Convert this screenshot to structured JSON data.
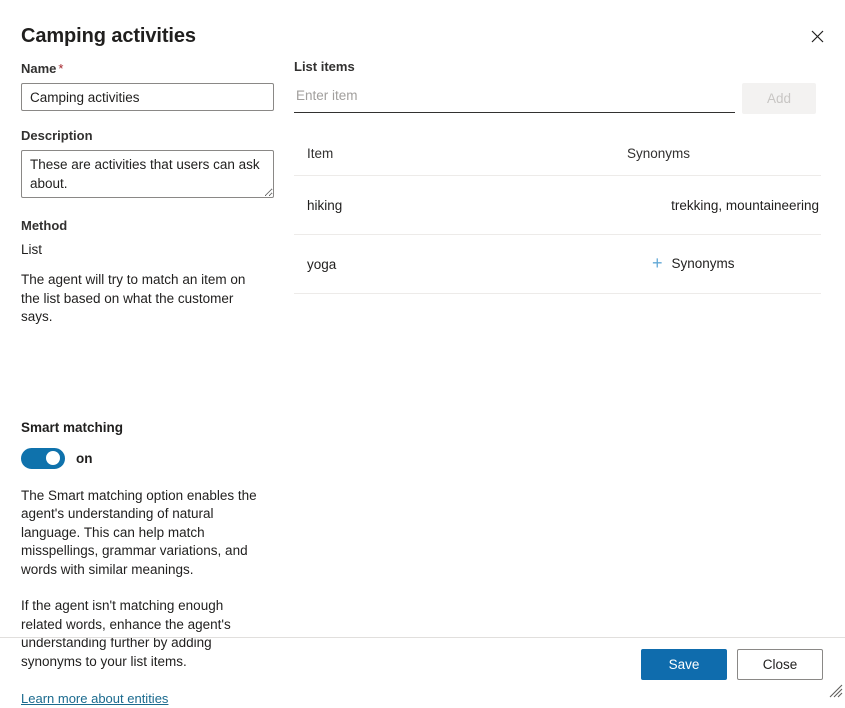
{
  "dialog": {
    "title": "Camping activities",
    "close_icon": "close-icon"
  },
  "form": {
    "name_label": "Name",
    "required_marker": "*",
    "name_value": "Camping activities",
    "name_placeholder": "",
    "description_label": "Description",
    "description_value": "These are activities that users can ask about.",
    "description_placeholder": "",
    "method_label": "Method",
    "method_value": "List",
    "method_helper": "The agent will try to match an item on the list based on what the customer says."
  },
  "smart_matching": {
    "title": "Smart matching",
    "toggle_state": "on",
    "toggle_on": true,
    "toggle_color": "#0f72ac",
    "paragraph_1": "The Smart matching option enables the agent's understanding of natural language. This can help match misspellings, grammar variations, and words with similar meanings.",
    "paragraph_2": "If the agent isn't matching enough related words, enhance the agent's understanding further by adding synonyms to your list items.",
    "link_text": "Learn more about entities",
    "link_color": "#1a6a8e"
  },
  "list_items": {
    "label": "List items",
    "input_value": "",
    "input_placeholder": "Enter item",
    "add_button_label": "Add",
    "add_button_disabled": true,
    "columns": {
      "item": "Item",
      "synonyms": "Synonyms"
    },
    "rows": [
      {
        "item": "hiking",
        "synonyms": "trekking, mountaineering",
        "has_synonyms": true
      },
      {
        "item": "yoga",
        "synonyms": "Synonyms",
        "has_synonyms": false,
        "add_icon": "plus-icon"
      }
    ]
  },
  "footer": {
    "save_label": "Save",
    "close_label": "Close",
    "primary_color": "#0f6cad"
  }
}
